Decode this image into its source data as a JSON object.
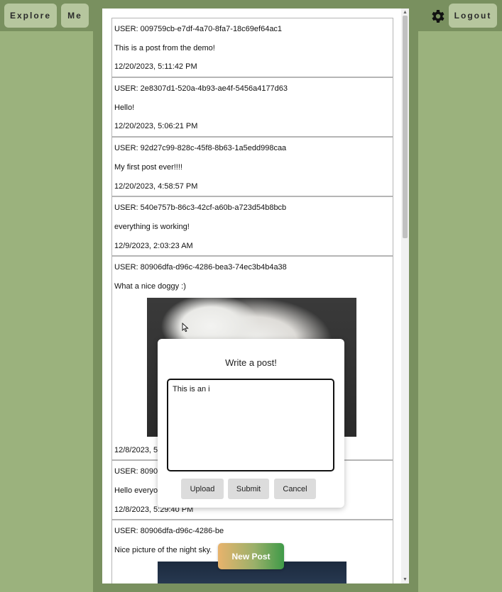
{
  "nav": {
    "explore_label": "Explore",
    "me_label": "Me",
    "logout_label": "Logout",
    "settings_icon": "gear-icon"
  },
  "feed": {
    "posts": [
      {
        "user": "USER: 009759cb-e7df-4a70-8fa7-18c69ef64ac1",
        "text": "This is a post from the demo!",
        "time": "12/20/2023, 5:11:42 PM"
      },
      {
        "user": "USER: 2e8307d1-520a-4b93-ae4f-5456a4177d63",
        "text": "Hello!",
        "time": "12/20/2023, 5:06:21 PM"
      },
      {
        "user": "USER: 92d27c99-828c-45f8-8b63-1a5edd998caa",
        "text": "My first post ever!!!!",
        "time": "12/20/2023, 4:58:57 PM"
      },
      {
        "user": "USER: 540e757b-86c3-42cf-a60b-a723d54b8bcb",
        "text": "everything is working!",
        "time": "12/9/2023, 2:03:23 AM"
      },
      {
        "user": "USER: 80906dfa-d96c-4286-bea3-74ec3b4b4a38",
        "text": "What a nice doggy :)",
        "time": "12/8/2023, 5:"
      },
      {
        "user": "USER: 80906",
        "text": "Hello everyor",
        "time": "12/8/2023, 5:29:40 PM"
      },
      {
        "user": "USER: 80906dfa-d96c-4286-be",
        "text": "Nice picture of the night sky."
      }
    ]
  },
  "modal": {
    "title": "Write a post!",
    "textarea_value": "This is an i",
    "upload_label": "Upload",
    "submit_label": "Submit",
    "cancel_label": "Cancel"
  },
  "new_post_label": "New Post",
  "colors": {
    "background": "#79905f",
    "side_panel": "#9bb27d",
    "nav_button": "#b6c69e"
  }
}
